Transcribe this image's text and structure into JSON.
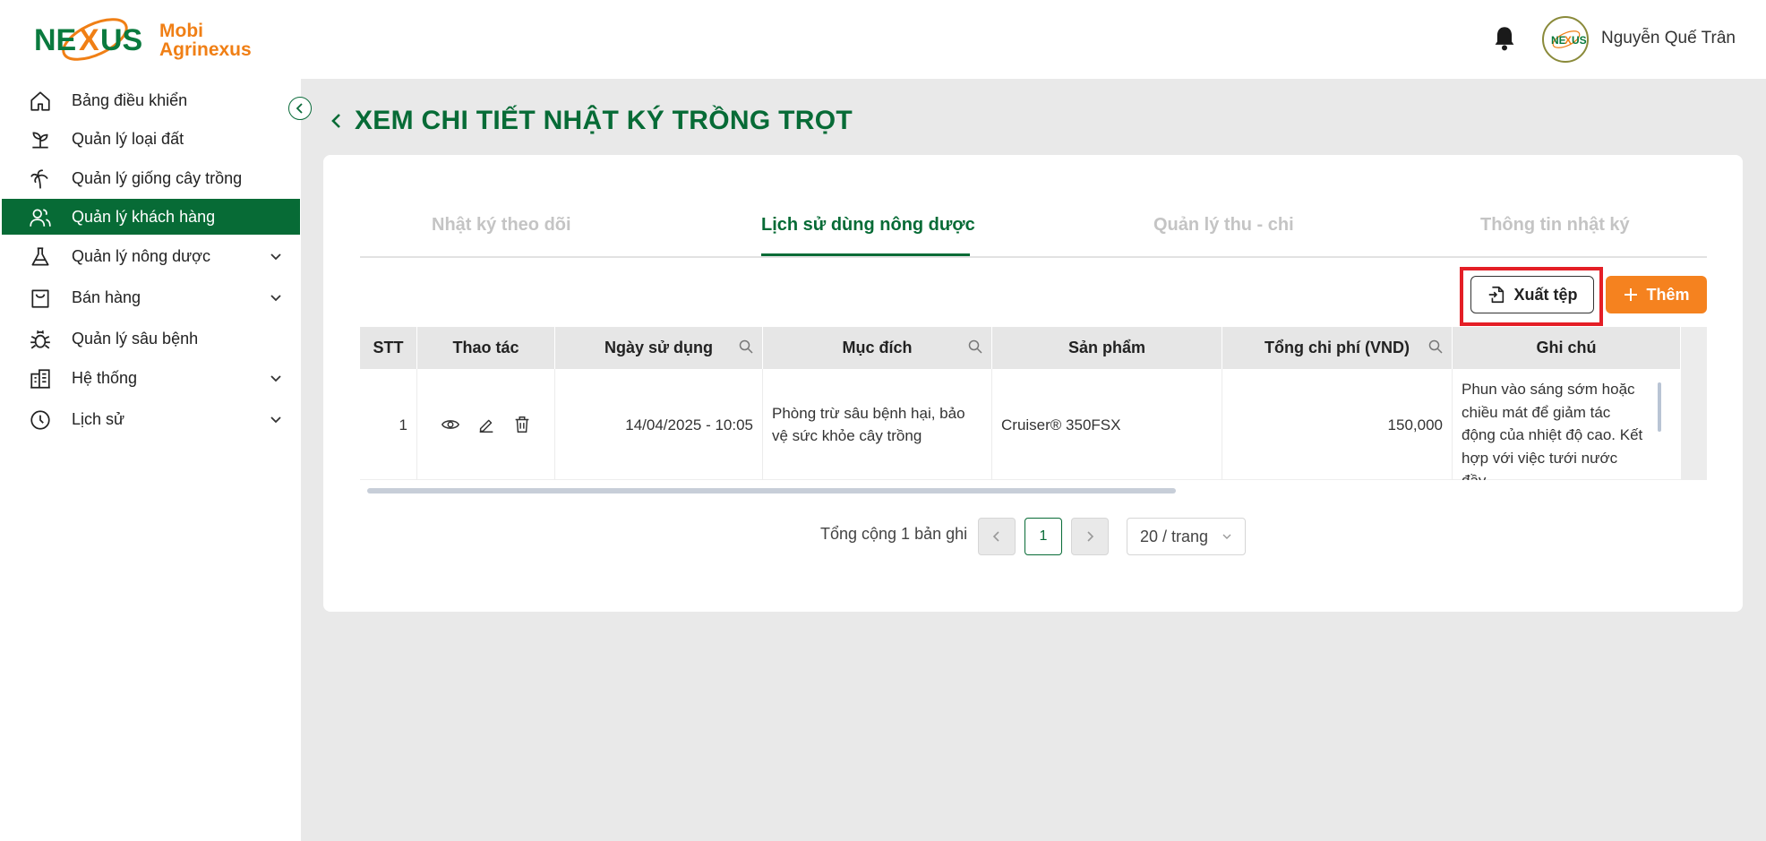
{
  "brand": {
    "logo_text": "NEXUS",
    "name_line1": "Mobi",
    "name_line2": "Agrinexus"
  },
  "header": {
    "user_name": "Nguyễn Quế Trân",
    "avatar_text": "NEXUS"
  },
  "sidebar": {
    "items": [
      {
        "label": "Bảng điều khiển",
        "icon": "home-icon",
        "has_children": false,
        "active": false
      },
      {
        "label": "Quản lý loại đất",
        "icon": "sprout-icon",
        "has_children": false,
        "active": false
      },
      {
        "label": "Quản lý giống cây trồng",
        "icon": "palm-tree-icon",
        "has_children": false,
        "active": false
      },
      {
        "label": "Quản lý khách hàng",
        "icon": "users-icon",
        "has_children": false,
        "active": true
      },
      {
        "label": "Quản lý nông dược",
        "icon": "flask-icon",
        "has_children": true,
        "active": false
      },
      {
        "label": "Bán hàng",
        "icon": "shopping-bag-icon",
        "has_children": true,
        "active": false
      },
      {
        "label": "Quản lý sâu bệnh",
        "icon": "bug-icon",
        "has_children": false,
        "active": false
      },
      {
        "label": "Hệ thống",
        "icon": "building-icon",
        "has_children": true,
        "active": false
      },
      {
        "label": "Lịch sử",
        "icon": "clock-icon",
        "has_children": true,
        "active": false
      }
    ]
  },
  "page": {
    "title": "XEM CHI TIẾT NHẬT KÝ TRỒNG TRỌT"
  },
  "tabs": [
    {
      "label": "Nhật ký theo dõi",
      "active": false
    },
    {
      "label": "Lịch sử dùng nông dược",
      "active": true
    },
    {
      "label": "Quản lý thu - chi",
      "active": false
    },
    {
      "label": "Thông tin nhật ký",
      "active": false
    }
  ],
  "toolbar": {
    "export_label": "Xuất tệp",
    "add_label": "Thêm"
  },
  "table": {
    "columns": [
      "STT",
      "Thao tác",
      "Ngày sử dụng",
      "Mục đích",
      "Sản phẩm",
      "Tổng chi phí (VND)",
      "Ghi chú"
    ],
    "rows": [
      {
        "stt": "1",
        "date": "14/04/2025 - 10:05",
        "purpose": "Phòng trừ sâu bệnh hại, bảo vệ sức khỏe cây trồng",
        "product": "Cruiser® 350FSX",
        "total": "150,000",
        "note": "Phun vào sáng sớm hoặc chiều mát để giảm tác động của nhiệt độ cao. Kết hợp với việc tưới nước đầy"
      }
    ]
  },
  "pagination": {
    "total_text": "Tổng cộng 1 bản ghi",
    "current_page": "1",
    "page_size": "20 / trang"
  },
  "colors": {
    "primary_green": "#076b36",
    "accent_orange": "#f5821f",
    "highlight_red": "#e41e26"
  }
}
